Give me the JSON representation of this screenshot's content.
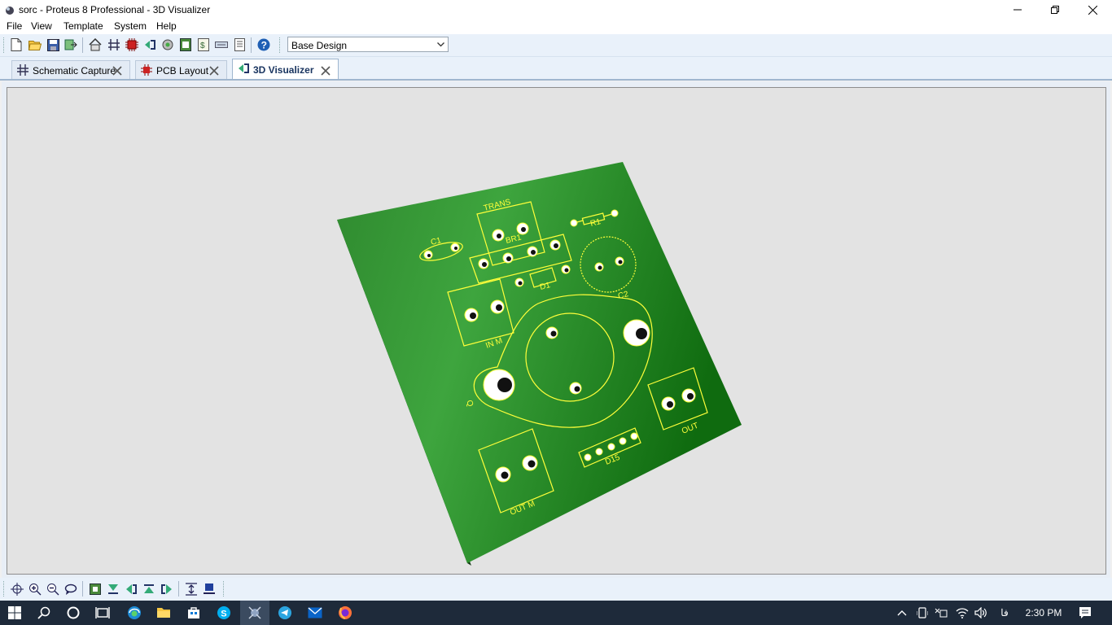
{
  "window": {
    "title": "sorc - Proteus 8 Professional - 3D Visualizer",
    "controls": {
      "minimize": "minimize-icon",
      "restore": "restore-icon",
      "close": "close-icon"
    }
  },
  "menu": {
    "items": [
      "File",
      "View",
      "Template",
      "System",
      "Help"
    ]
  },
  "toolbar": {
    "icons": [
      "new-file-icon",
      "open-folder-icon",
      "save-icon",
      "import-icon",
      "home-icon",
      "schematic-icon",
      "pcb-icon",
      "gerber-icon",
      "visualizer-icon",
      "bom-icon",
      "design-notes-icon",
      "netlist-icon",
      "report-icon",
      "help-icon"
    ],
    "design_select": {
      "value": "Base Design",
      "arrow": "chevron-down-icon"
    }
  },
  "tabs": [
    {
      "label": "Schematic Capture",
      "icon": "schematic-tab-icon",
      "active": false
    },
    {
      "label": "PCB Layout",
      "icon": "pcb-tab-icon",
      "active": false
    },
    {
      "label": "3D Visualizer",
      "icon": "visualizer-tab-icon",
      "active": true
    }
  ],
  "board": {
    "silkscreen_labels": [
      "TRANS",
      "R1",
      "C1",
      "BR1",
      "D1",
      "C2",
      "IN M",
      "Q",
      "OUT",
      "D15",
      "OUT M"
    ],
    "colors": {
      "board": "#3a9c3a",
      "edge": "#173d17",
      "silkscreen": "#ffff3a",
      "background": "#e3e3e3"
    }
  },
  "view_controls": {
    "icons": [
      "pan-icon",
      "zoom-in-icon",
      "zoom-out-icon",
      "rotate-icon",
      "top-view-icon",
      "front-view-icon",
      "left-view-icon",
      "back-view-icon",
      "right-view-icon",
      "fit-height-icon",
      "bottom-view-icon"
    ]
  },
  "taskbar": {
    "apps": [
      "windows-start-icon",
      "search-icon",
      "cortana-icon",
      "task-view-icon",
      "edge-icon",
      "file-explorer-icon",
      "store-icon",
      "skype-icon",
      "proteus-icon",
      "telegram-icon",
      "mail-icon",
      "firefox-icon"
    ],
    "tray_icons": [
      "chevron-up-icon",
      "device-icon",
      "keyboard-icon",
      "wifi-icon",
      "volume-icon"
    ],
    "language": "فا",
    "time": "2:30 PM",
    "notifications": "notification-icon"
  }
}
